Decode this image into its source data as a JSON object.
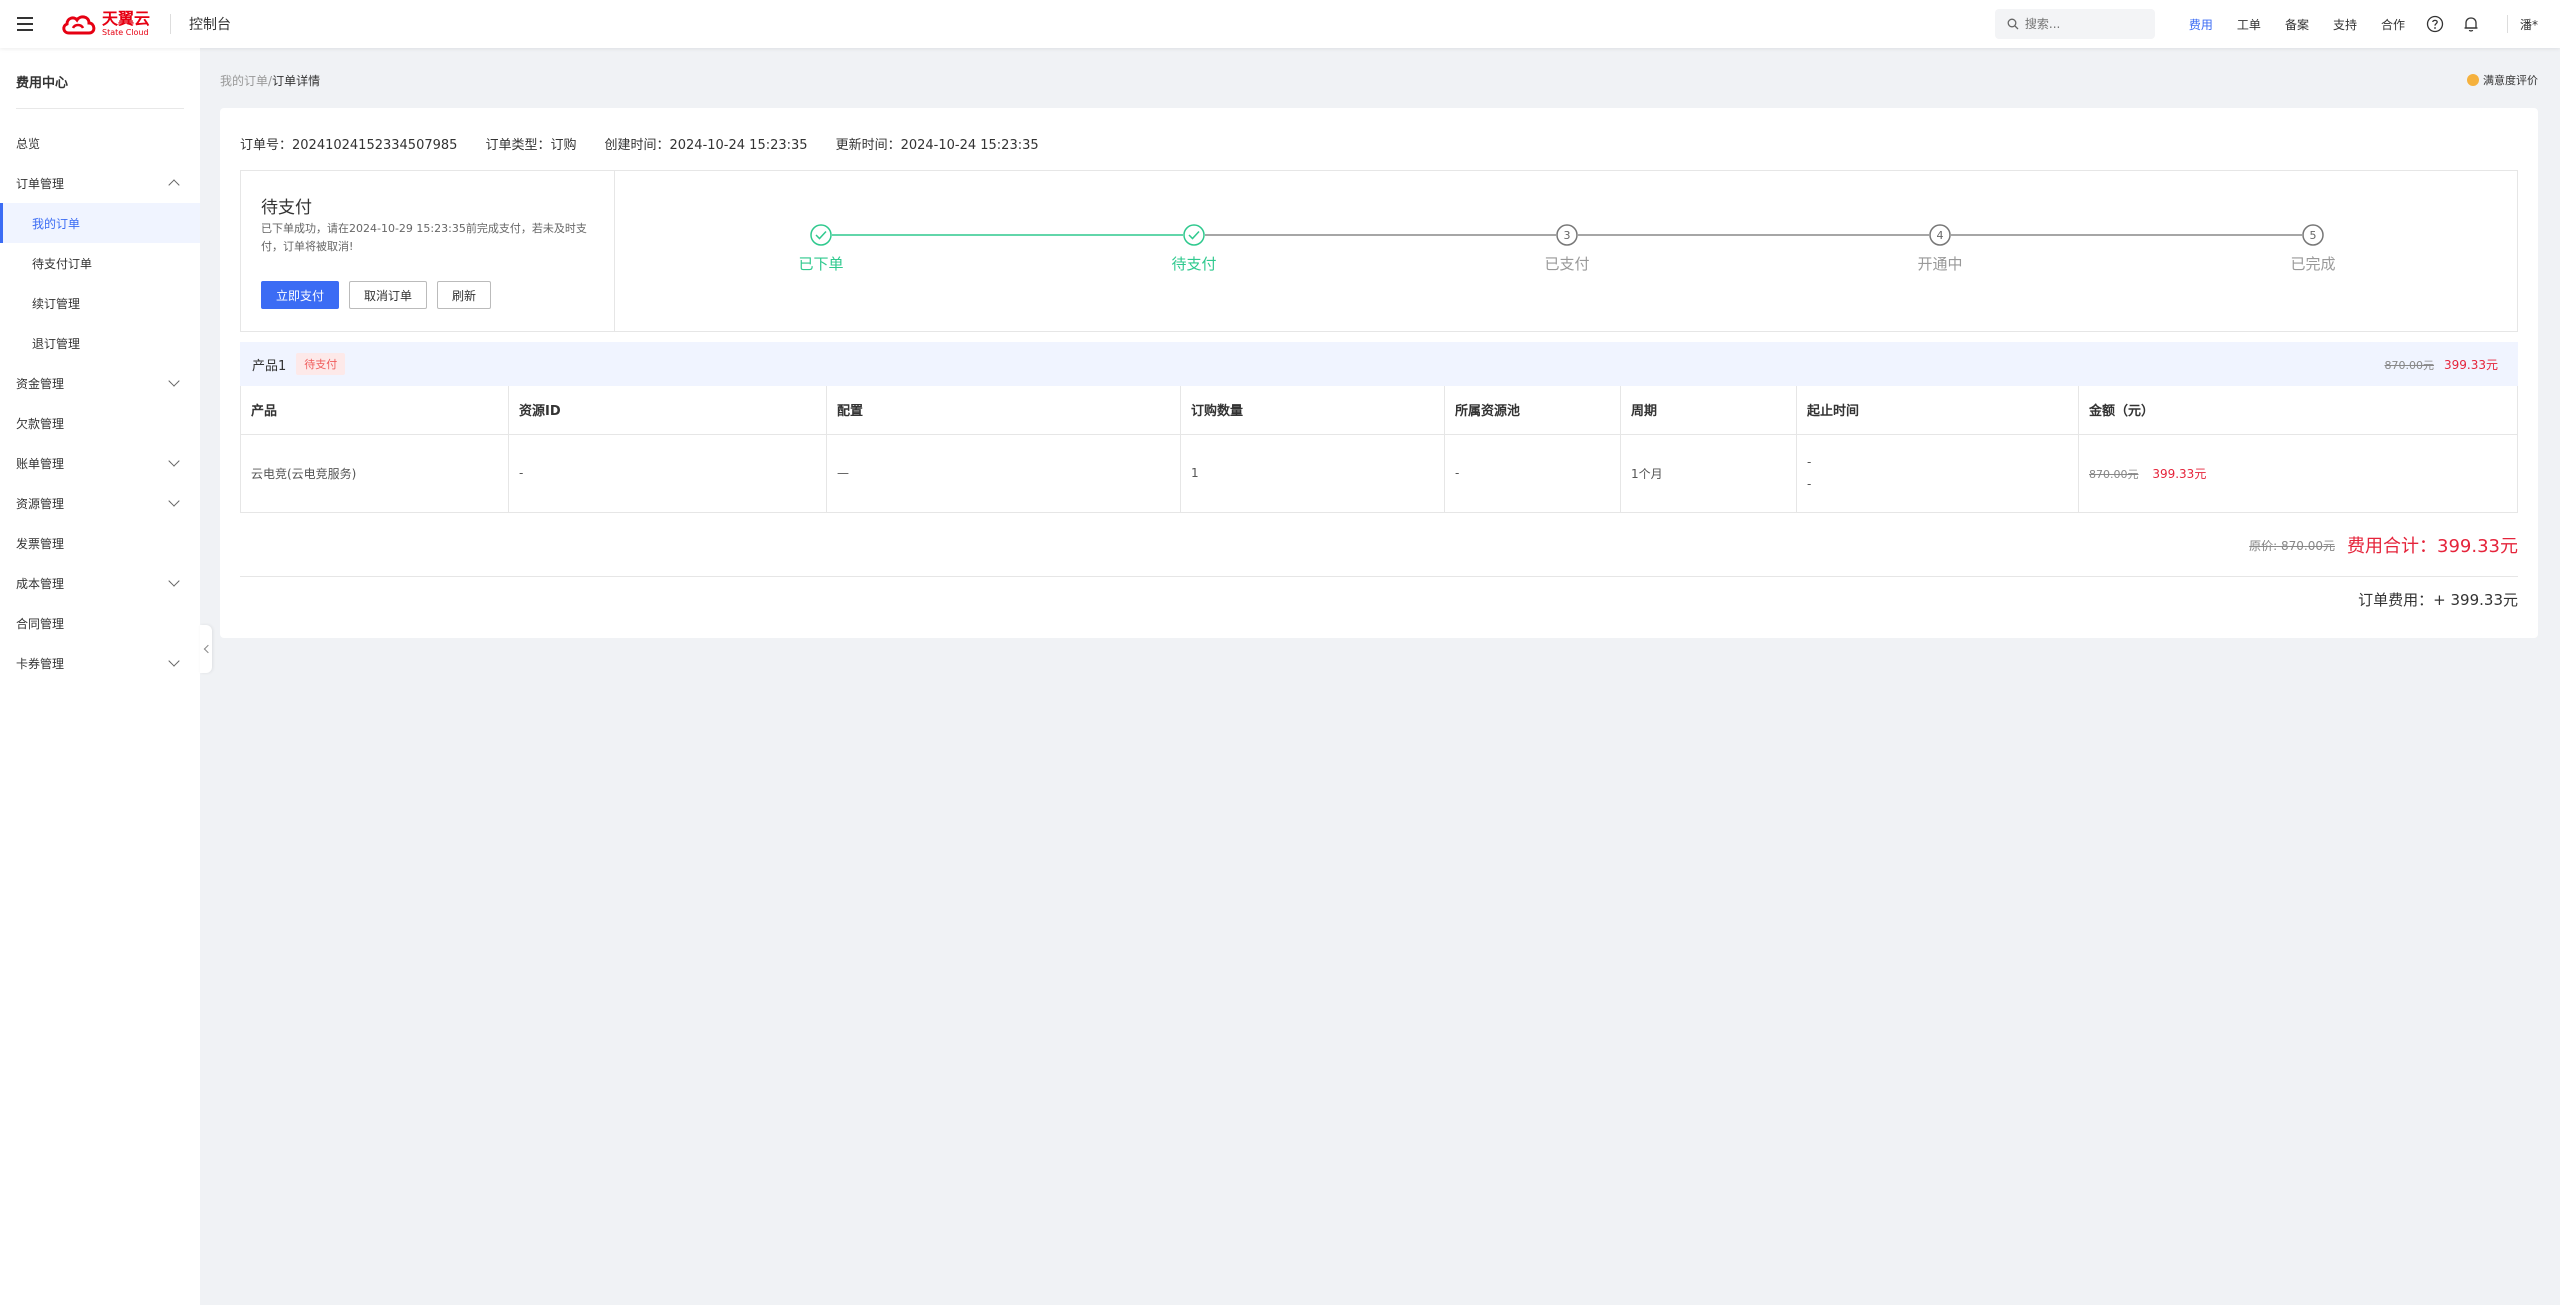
{
  "topbar": {
    "brand_cn": "天翼云",
    "brand_en": "State Cloud",
    "console": "控制台",
    "search_placeholder": "搜索...",
    "links": [
      "费用",
      "工单",
      "备案",
      "支持",
      "合作"
    ],
    "active_link": "费用",
    "user": "潘*",
    "accent": "#3b6cf4",
    "brand_color": "#e60012"
  },
  "sidebar": {
    "title": "费用中心",
    "items": [
      {
        "label": "总览"
      },
      {
        "label": "订单管理"
      },
      {
        "label": "我的订单"
      },
      {
        "label": "待支付订单"
      },
      {
        "label": "续订管理"
      },
      {
        "label": "退订管理"
      },
      {
        "label": "资金管理"
      },
      {
        "label": "欠款管理"
      },
      {
        "label": "账单管理"
      },
      {
        "label": "资源管理"
      },
      {
        "label": "发票管理"
      },
      {
        "label": "成本管理"
      },
      {
        "label": "合同管理"
      },
      {
        "label": "卡券管理"
      }
    ]
  },
  "breadcrumb": {
    "parent": "我的订单",
    "sep": "/",
    "current": "订单详情"
  },
  "rating": "满意度评价",
  "order": {
    "id_label": "订单号：",
    "id": "20241024152334507985",
    "type_label": "订单类型：",
    "type": "订购",
    "created_label": "创建时间：",
    "created": "2024-10-24 15:23:35",
    "updated_label": "更新时间：",
    "updated": "2024-10-24 15:23:35"
  },
  "status": {
    "title": "待支付",
    "desc": "已下单成功，请在2024-10-29 15:23:35前完成支付，若未及时支付，订单将被取消!",
    "pay_button": "立即支付",
    "cancel_button": "取消订单",
    "refresh_button": "刷新",
    "steps": [
      {
        "label": "已下单",
        "num": "1",
        "done": true
      },
      {
        "label": "待支付",
        "num": "2",
        "done": true
      },
      {
        "label": "已支付",
        "num": "3",
        "done": false
      },
      {
        "label": "开通中",
        "num": "4",
        "done": false
      },
      {
        "label": "已完成",
        "num": "5",
        "done": false
      }
    ],
    "done_color": "#2fc98e"
  },
  "product": {
    "name": "产品1",
    "tag": "待支付",
    "original_price": "870.00元",
    "price": "399.33元",
    "columns": [
      "产品",
      "资源ID",
      "配置",
      "订购数量",
      "所属资源池",
      "周期",
      "起止时间",
      "金额（元）"
    ],
    "row": {
      "product": "云电竞(云电竞服务)",
      "resource_id": "-",
      "config": "—",
      "quantity": "1",
      "pool": "-",
      "period": "1个月",
      "time_start": "-",
      "time_end": "-",
      "amount_original": "870.00元",
      "amount": "399.33元"
    }
  },
  "totals": {
    "original_label": "原价: 870.00元",
    "total_label": "费用合计：399.33元",
    "order_fee": "订单费用：+ 399.33元"
  }
}
